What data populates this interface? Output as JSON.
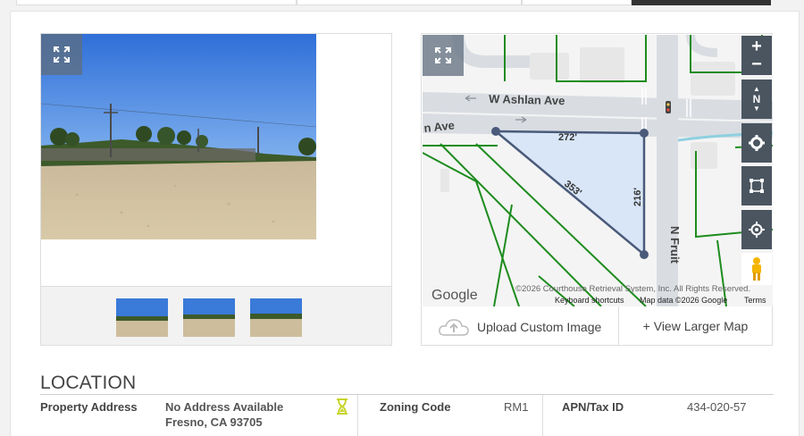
{
  "map": {
    "street_ashlan": "W Ashlan Ave",
    "street_ashlan_partial": "n Ave",
    "street_fruit": "N Fruit",
    "dim_top": "272'",
    "dim_diag": "353'",
    "dim_right": "216'",
    "google_logo": "Google",
    "copyright": "©2026 Courthouse Retrieval System, Inc. All Rights Reserved.",
    "keyboard_shortcuts": "Keyboard shortcuts",
    "map_data": "Map data ©2026 Google",
    "terms": "Terms",
    "zoom_in": "+",
    "zoom_out": "−",
    "compass": "N"
  },
  "actions": {
    "upload_label": "Upload Custom Image",
    "view_larger_label": "+ View Larger Map"
  },
  "location": {
    "title": "LOCATION",
    "address_label": "Property Address",
    "address_line1": "No Address Available",
    "address_line2": "Fresno, CA 93705",
    "zoning_label": "Zoning Code",
    "zoning_value": "RM1",
    "apn_label": "APN/Tax ID",
    "apn_value": "434-020-57"
  },
  "colors": {
    "accent_hourglass": "#c8d42a",
    "parcel_fill": "#d8e6f7",
    "parcel_line": "#4a5a7a",
    "lot_lines": "#1e8c1e",
    "map_control": "#4a5560"
  }
}
